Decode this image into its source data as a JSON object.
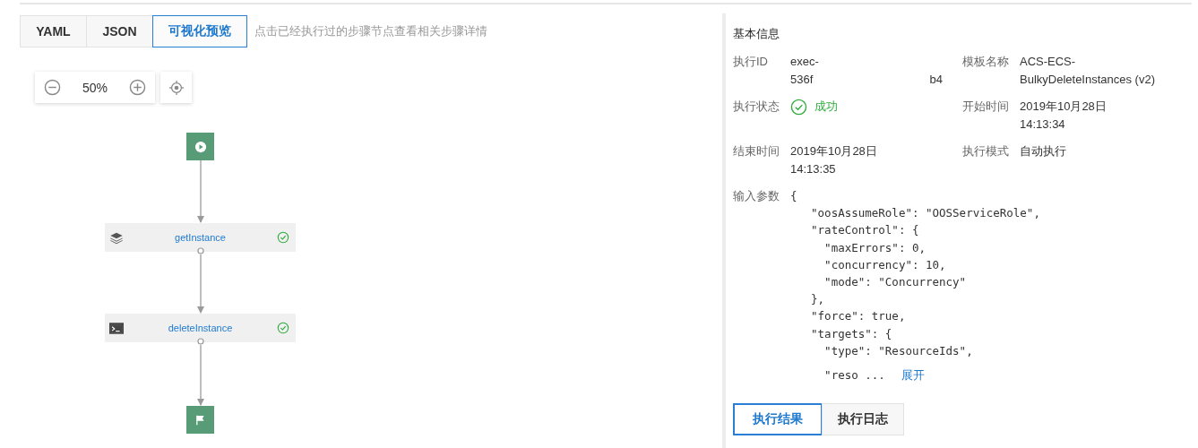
{
  "view_tabs": [
    {
      "label": "YAML",
      "selected": false
    },
    {
      "label": "JSON",
      "selected": false
    },
    {
      "label": "可视化预览",
      "selected": true
    }
  ],
  "hint": "点击已经执行过的步骤节点查看相关步骤详情",
  "zoom": {
    "value": "50%"
  },
  "flow": {
    "steps": [
      {
        "name": "getInstance",
        "kind": "layers",
        "success": true
      },
      {
        "name": "deleteInstance",
        "kind": "terminal",
        "success": true
      }
    ]
  },
  "info": {
    "title": "基本信息",
    "fields": [
      {
        "label": "执行ID",
        "kind": "redacted",
        "lines": [
          "exec-",
          "536f"
        ],
        "tail": "b4"
      },
      {
        "label": "模板名称",
        "kind": "text",
        "lines": [
          "ACS-ECS-",
          "BulkyDeleteInstances (v2)"
        ]
      },
      {
        "label": "执行状态",
        "kind": "status",
        "success": true,
        "lines": [
          "成功"
        ]
      },
      {
        "label": "开始时间",
        "kind": "text",
        "lines": [
          "2019年10月28日",
          "14:13:34"
        ]
      },
      {
        "label": "结束时间",
        "kind": "text",
        "lines": [
          "2019年10月28日",
          "14:13:35"
        ]
      },
      {
        "label": "执行模式",
        "kind": "text",
        "lines": [
          "自动执行"
        ]
      }
    ],
    "params": {
      "label": "输入参数",
      "open": "{",
      "lines": [
        "  \"oosAssumeRole\": \"OOSServiceRole\",",
        "  \"rateControl\": {",
        "    \"maxErrors\": 0,",
        "    \"concurrency\": 10,",
        "    \"mode\": \"Concurrency\"",
        "  },",
        "  \"force\": true,",
        "  \"targets\": {",
        "    \"type\": \"ResourceIds\","
      ],
      "last": "    \"reso ...",
      "expand": "展开"
    }
  },
  "result_tabs": [
    {
      "label": "执行结果",
      "selected": true
    },
    {
      "label": "执行日志",
      "selected": false
    }
  ]
}
